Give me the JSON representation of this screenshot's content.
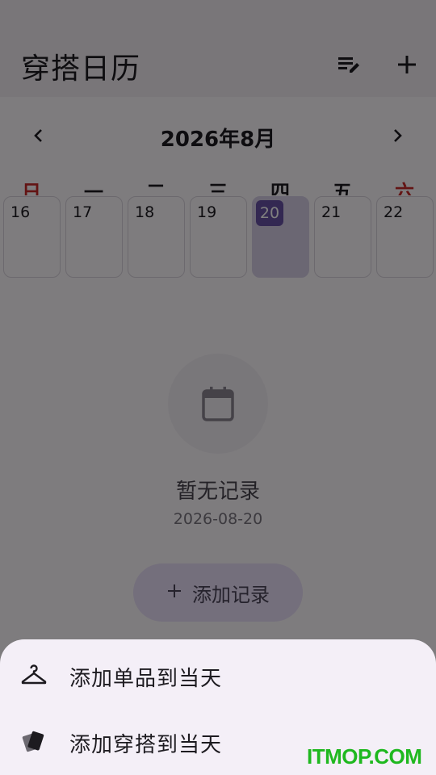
{
  "appbar": {
    "title": "穿搭日历",
    "edit_list_icon": "playlist-edit-icon",
    "add_icon": "plus-icon"
  },
  "calendar": {
    "month_label": "2026年8月",
    "prev_icon": "chevron-left-icon",
    "next_icon": "chevron-right-icon",
    "weekdays": [
      "日",
      "一",
      "二",
      "三",
      "四",
      "五",
      "六"
    ],
    "weekend_color": "#c62828",
    "days": [
      "16",
      "17",
      "18",
      "19",
      "20",
      "21",
      "22"
    ],
    "selected_day": "20"
  },
  "empty_state": {
    "icon": "calendar-icon",
    "title": "暂无记录",
    "date": "2026-08-20"
  },
  "add_record": {
    "icon": "plus-icon",
    "label": "添加记录"
  },
  "sheet": {
    "items": [
      {
        "icon": "hanger-icon",
        "label": "添加单品到当天"
      },
      {
        "icon": "cards-icon",
        "label": "添加穿搭到当天"
      }
    ]
  },
  "colors": {
    "primary": "#6750a4",
    "selected_bg": "#d6cfe6",
    "tonal_button": "#e8def8"
  },
  "watermark": "ITMOP.COM"
}
